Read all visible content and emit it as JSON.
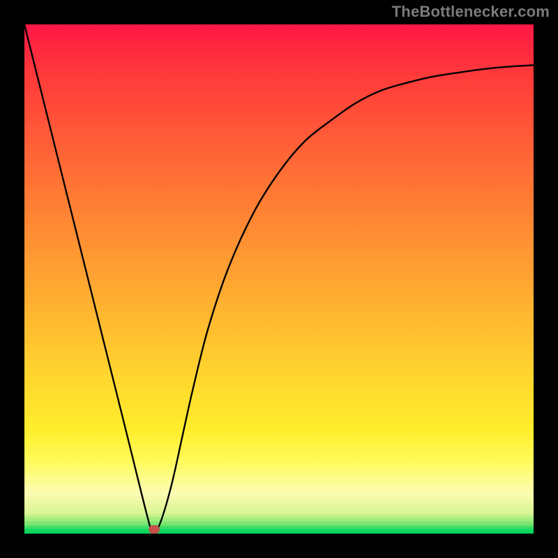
{
  "watermark": "TheBottlenecker.com",
  "marker": {
    "x_frac": 0.255,
    "y_frac": 0.992
  },
  "chart_data": {
    "type": "line",
    "title": "",
    "xlabel": "",
    "ylabel": "",
    "xlim": [
      0,
      1
    ],
    "ylim": [
      0,
      1
    ],
    "series": [
      {
        "name": "curve",
        "x": [
          0.0,
          0.05,
          0.1,
          0.15,
          0.2,
          0.245,
          0.255,
          0.27,
          0.29,
          0.31,
          0.33,
          0.36,
          0.4,
          0.45,
          0.5,
          0.55,
          0.6,
          0.65,
          0.7,
          0.75,
          0.8,
          0.85,
          0.9,
          0.95,
          1.0
        ],
        "y": [
          1.0,
          0.8,
          0.6,
          0.4,
          0.2,
          0.02,
          0.0,
          0.03,
          0.1,
          0.19,
          0.28,
          0.4,
          0.52,
          0.63,
          0.71,
          0.77,
          0.81,
          0.845,
          0.87,
          0.885,
          0.897,
          0.905,
          0.912,
          0.917,
          0.92
        ]
      }
    ],
    "marker": {
      "name": "min-point",
      "x": 0.255,
      "y": 0.0
    },
    "background_gradient": {
      "top": "#ff1744",
      "mid": "#ffd82e",
      "pale": "#fdfcb0",
      "bottom": "#00d45a"
    }
  }
}
